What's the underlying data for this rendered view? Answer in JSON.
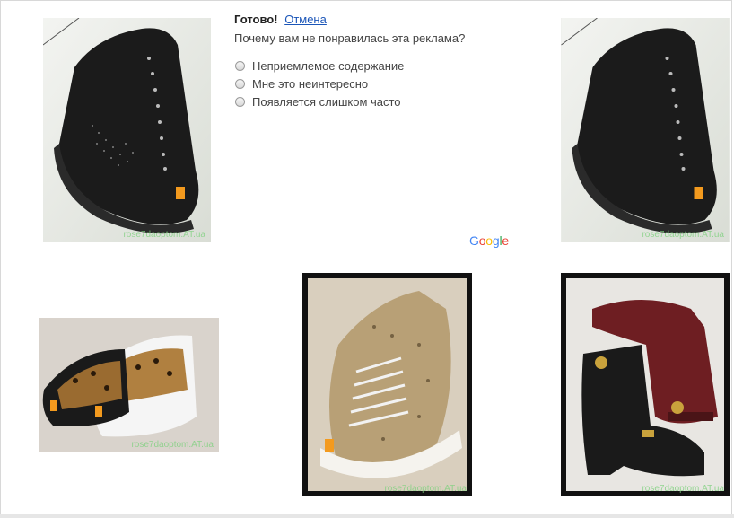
{
  "feedback": {
    "done_label": "Готово!",
    "cancel_label": "Отмена",
    "question": "Почему вам не понравилась эта реклама?",
    "options": [
      "Неприемлемое содержание",
      "Мне это неинтересно",
      "Появляется слишком часто"
    ]
  },
  "brand": {
    "logo_letters": [
      "G",
      "o",
      "o",
      "g",
      "l",
      "e"
    ],
    "logo_colors": [
      "#4285F4",
      "#EA4335",
      "#FBBC05",
      "#4285F4",
      "#34A853",
      "#EA4335"
    ]
  },
  "products": {
    "watermarks": [
      "rose7daoptom.AT.ua",
      "rose7daoptom.AT.ua",
      "rose7daoptom.AT.ua",
      "rose7daoptom.AT.ua",
      "rose7daoptom.AT.ua"
    ]
  },
  "colors": {
    "link": "#1a55b8",
    "text": "#444444"
  }
}
